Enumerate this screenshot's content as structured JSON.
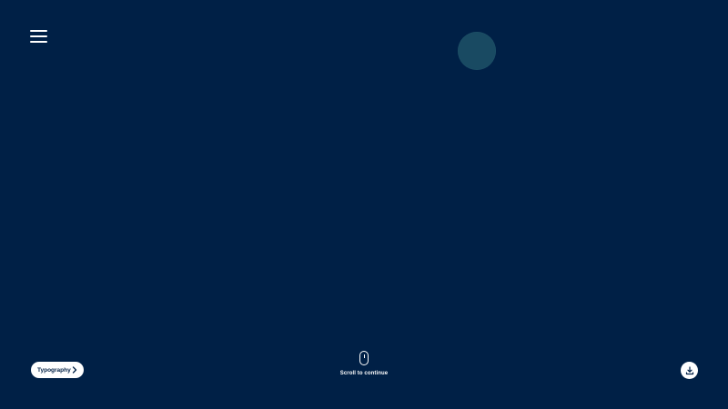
{
  "colors": {
    "background": "#002046",
    "accent_circle": "#1c4f66",
    "foreground": "#ffffff"
  },
  "header": {
    "menu_icon": "hamburger-icon"
  },
  "scroll_hint": {
    "icon": "mouse-icon",
    "label": "Scroll to continue"
  },
  "nav": {
    "label": "Typography",
    "icon": "chevron-right-icon"
  },
  "download": {
    "icon": "download-icon"
  }
}
